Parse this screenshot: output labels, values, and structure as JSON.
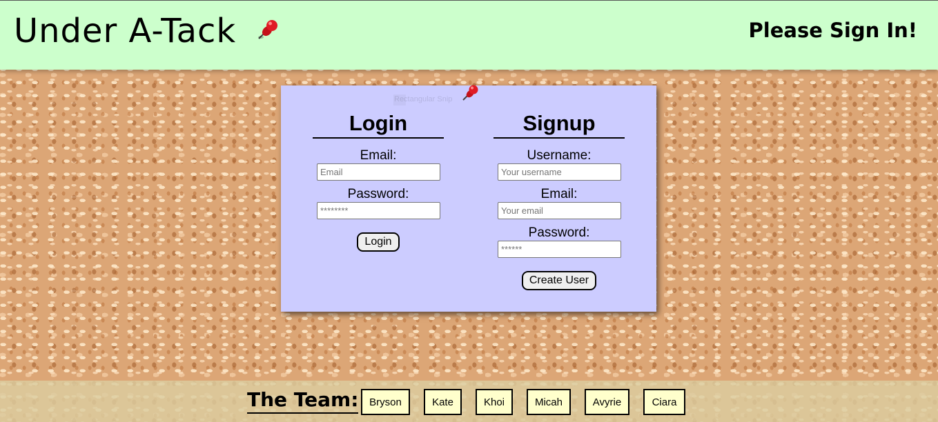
{
  "header": {
    "title": "Under A-Tack",
    "status": "Please Sign In!"
  },
  "card": {
    "ghost_text": "Rectangular Snip"
  },
  "login": {
    "heading": "Login",
    "email_label": "Email:",
    "email_placeholder": "Email",
    "password_label": "Password:",
    "password_placeholder": "********",
    "button": "Login"
  },
  "signup": {
    "heading": "Signup",
    "username_label": "Username:",
    "username_placeholder": "Your username",
    "email_label": "Email:",
    "email_placeholder": "Your email",
    "password_label": "Password:",
    "password_placeholder": "******",
    "button": "Create User"
  },
  "footer": {
    "team_label": "The Team:",
    "members": [
      "Bryson",
      "Kate",
      "Khoi",
      "Micah",
      "Avyrie",
      "Ciara"
    ]
  },
  "colors": {
    "header_bg": "#ccffcc",
    "card_bg": "#ccccff",
    "member_bg": "#ffffcc",
    "cork": "#dca676",
    "pin": "#e01b24"
  },
  "icons": {
    "pin": "pushpin-icon"
  }
}
